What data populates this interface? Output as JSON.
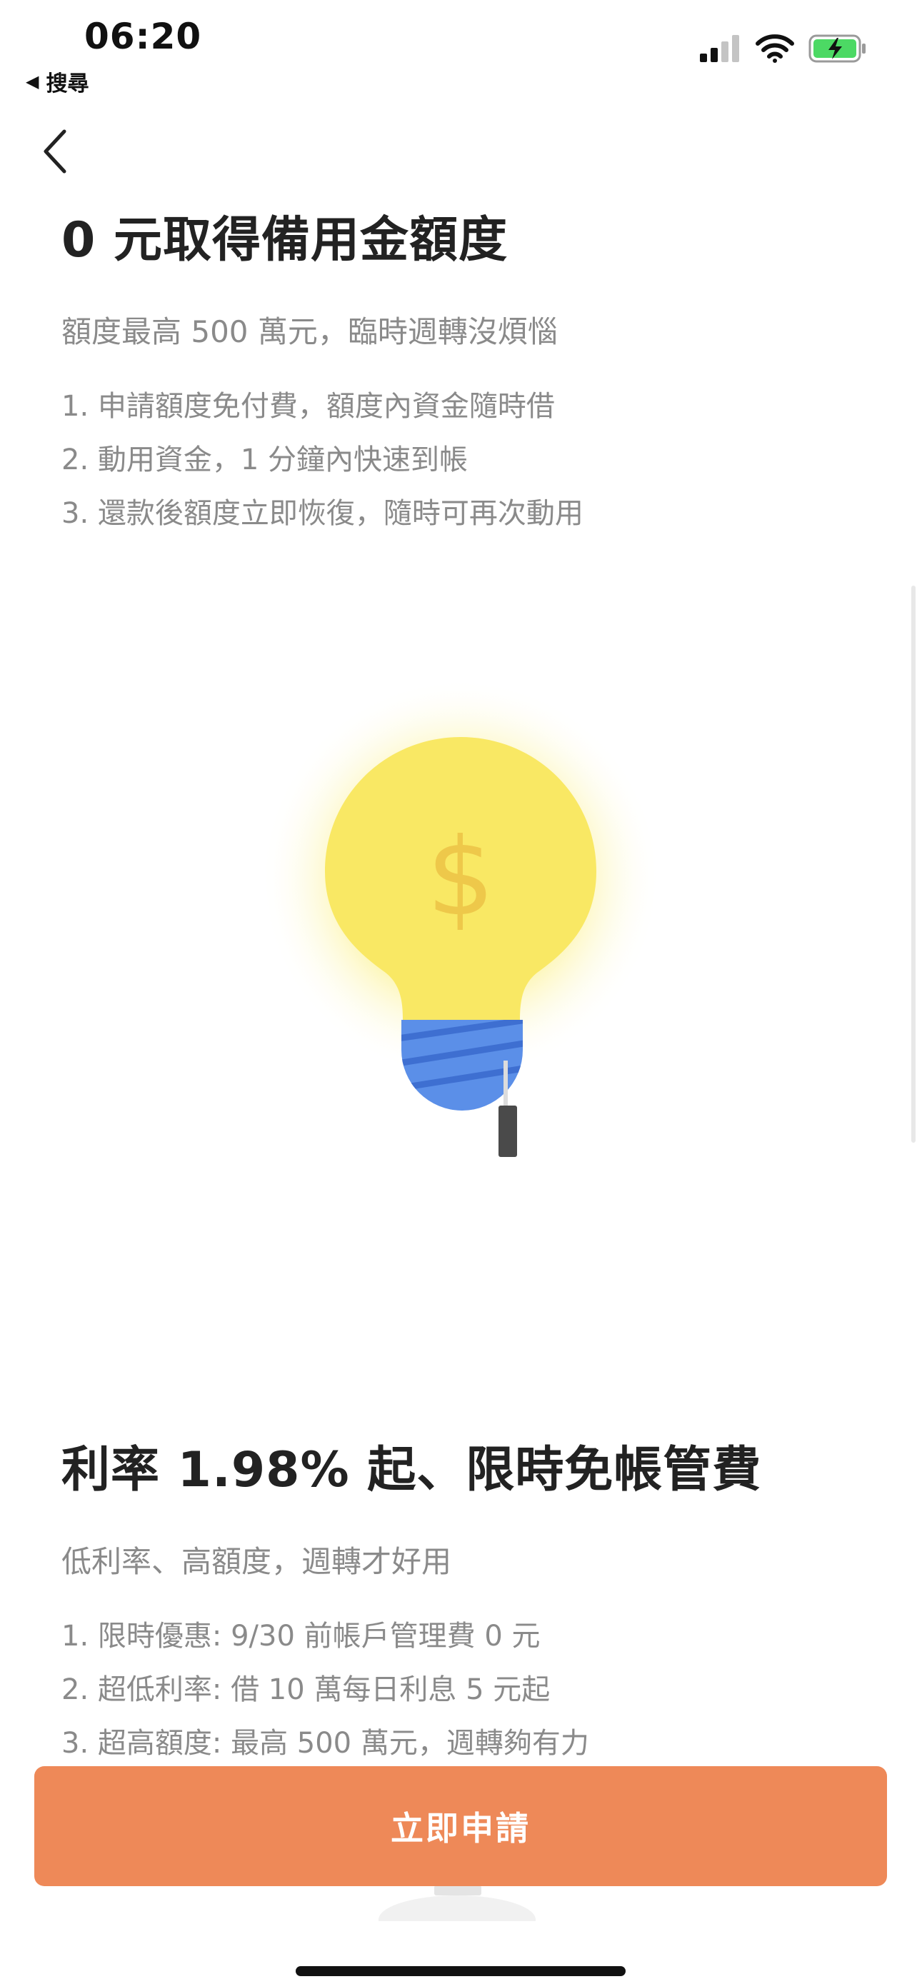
{
  "status_bar": {
    "time": "06:20",
    "back_app_label": "搜尋",
    "icons": [
      "signal-icon",
      "wifi-icon",
      "battery-charging-icon"
    ]
  },
  "nav": {
    "back_icon": "chevron-left-icon"
  },
  "section1": {
    "title": "0 元取得備用金額度",
    "subtitle": "額度最高 500 萬元，臨時週轉沒煩惱",
    "items": [
      "1. 申請額度免付費，額度內資金隨時借",
      "2. 動用資金，1 分鐘內快速到帳",
      "3. 還款後額度立即恢復，隨時可再次動用"
    ]
  },
  "illustration": {
    "icon": "dollar-lightbulb-icon",
    "symbol": "$"
  },
  "section2": {
    "title": "利率 1.98% 起、限時免帳管費",
    "subtitle": "低利率、高額度，週轉才好用",
    "items": [
      "1. 限時優惠: 9/30 前帳戶管理費 0 元",
      "2. 超低利率: 借 10 萬每日利息 5 元起",
      "3. 超高額度: 最高 500 萬元，週轉夠有力"
    ]
  },
  "cta": {
    "apply_label": "立即申請"
  },
  "colors": {
    "accent": "#ee8958",
    "bulb": "#f9e864",
    "bulb_glow": "#fdf6b0",
    "bulb_base": "#5b8fe8",
    "text_primary": "#222222",
    "text_secondary": "#8a8a8a"
  }
}
